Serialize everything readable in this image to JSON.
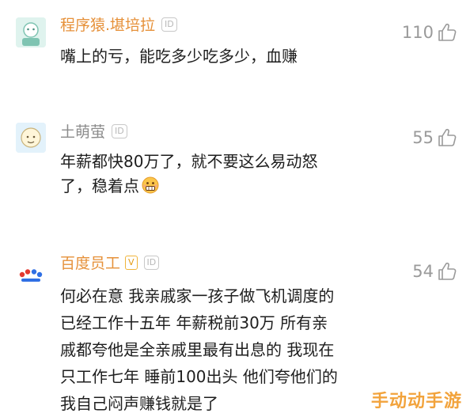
{
  "comments": [
    {
      "username": "程序猿.堪培拉",
      "username_color": "#e6913a",
      "id_badge": "ID",
      "likes": "110",
      "text_lines": [
        "嘴上的亏，能吃多少吃多少，血赚"
      ]
    },
    {
      "username": "土萌萤",
      "username_color": "#8c8c8c",
      "id_badge": "ID",
      "likes": "55",
      "text_lines": [
        "年薪都快80万了，就不要这么易动怒",
        "了，稳着点"
      ],
      "emoji": "grimacing-face-emoji"
    },
    {
      "username": "百度员工",
      "username_color": "#e6913a",
      "level_badge": "V",
      "id_badge": "ID",
      "likes": "54",
      "text_lines": [
        "何必在意 我亲戚家一孩子做飞机调度的",
        "已经工作十五年 年薪税前30万 所有亲",
        "戚都夸他是全亲戚里最有出息的 我现在",
        "只工作七年 睡前100出头 他们夸他们的",
        "我自己闷声赚钱就是了"
      ]
    }
  ],
  "watermark": "手动动手游",
  "colors": {
    "like_icon": "#9a9a9a",
    "watermark": "#f2a33c"
  }
}
